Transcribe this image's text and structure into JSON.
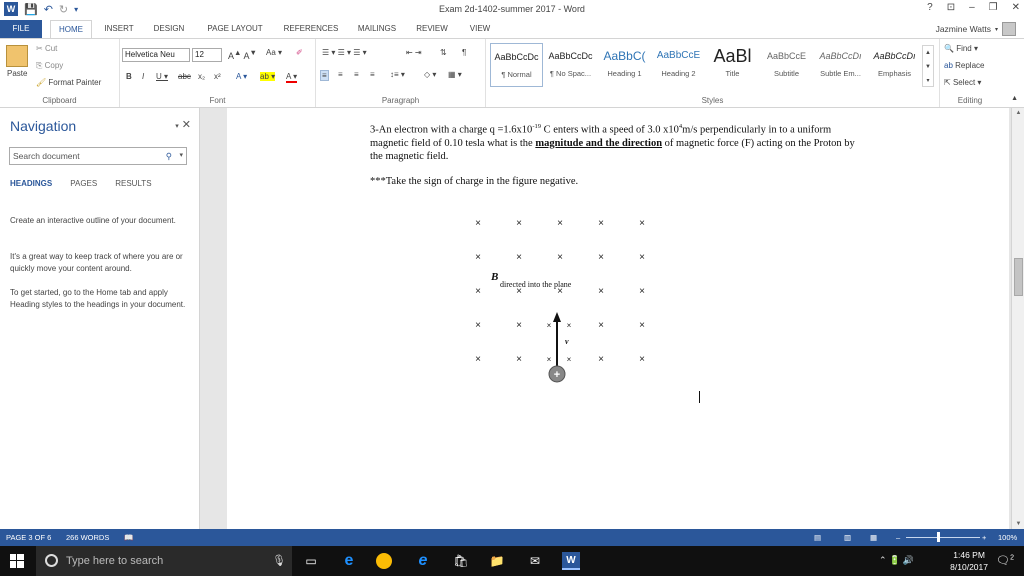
{
  "window": {
    "title": "Exam 2d-1402-summer 2017 - Word",
    "controls": [
      "?",
      "⊡",
      "–",
      "❐",
      "✕"
    ]
  },
  "tabs": {
    "file": "FILE",
    "items": [
      "HOME",
      "INSERT",
      "DESIGN",
      "PAGE LAYOUT",
      "REFERENCES",
      "MAILINGS",
      "REVIEW",
      "VIEW"
    ],
    "active": "HOME",
    "user": "Jazmine Watts"
  },
  "ribbon": {
    "clipboard": {
      "paste": "Paste",
      "cut": "Cut",
      "copy": "Copy",
      "format_painter": "Format Painter",
      "label": "Clipboard"
    },
    "font": {
      "name": "Helvetica Neu",
      "size": "12",
      "label": "Font"
    },
    "paragraph": {
      "label": "Paragraph"
    },
    "styles": {
      "label": "Styles",
      "items": [
        {
          "sample": "AaBbCcDc",
          "name": "¶ Normal"
        },
        {
          "sample": "AaBbCcDc",
          "name": "¶ No Spac..."
        },
        {
          "sample": "AaBbC(",
          "name": "Heading 1"
        },
        {
          "sample": "AaBbCcE",
          "name": "Heading 2"
        },
        {
          "sample": "AaBl",
          "name": "Title"
        },
        {
          "sample": "AaBbCcE",
          "name": "Subtitle"
        },
        {
          "sample": "AaBbCcDı",
          "name": "Subtle Em..."
        },
        {
          "sample": "AaBbCcDı",
          "name": "Emphasis"
        }
      ]
    },
    "editing": {
      "find": "Find",
      "replace": "Replace",
      "select": "Select",
      "label": "Editing"
    }
  },
  "navigation": {
    "title": "Navigation",
    "search_placeholder": "Search document",
    "tabs": [
      "HEADINGS",
      "PAGES",
      "RESULTS"
    ],
    "help": [
      "Create an interactive outline of your document.",
      "It's a great way to keep track of where you are or quickly move your content around.",
      "To get started, go to the Home tab and apply Heading styles to the headings in your document."
    ]
  },
  "document": {
    "question_pre": "3-An electron with a charge q =1.6x10",
    "exp1": "-19",
    "question_mid": " C enters with a speed of 3.0 x10",
    "exp2": "4",
    "question_mid2": "m/s perpendicularly in to a uniform magnetic field of 0.10 tesla what is the ",
    "question_emph": "magnitude and the direction",
    "question_post": " of magnetic force (F) acting on the Proton by the magnetic field.",
    "note": "***Take the sign of charge in the figure negative.",
    "figure": {
      "b_label": "B",
      "b_caption": "directed into the plane",
      "v_label": "v",
      "charge_sign": "+",
      "field_marker": "×"
    }
  },
  "status": {
    "page": "PAGE 3 OF 6",
    "words": "266 WORDS",
    "zoom": "100%"
  },
  "taskbar": {
    "search_placeholder": "Type here to search",
    "time": "1:46 PM",
    "date": "8/10/2017",
    "notifications": "2"
  }
}
